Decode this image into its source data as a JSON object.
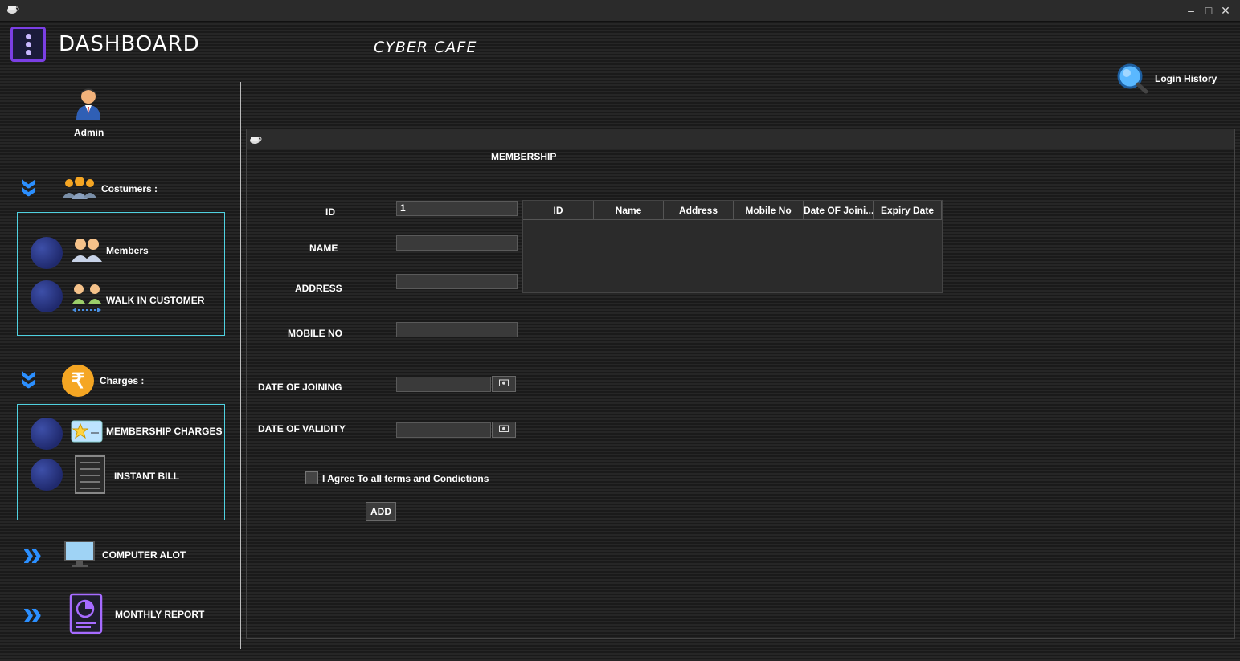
{
  "window": {
    "minimize": "–",
    "maximize": "□",
    "close": "✕"
  },
  "header": {
    "title": "DASHBOARD",
    "subtitle": "CYBER CAFE",
    "login_history": "Login History"
  },
  "user": {
    "name": "Admin"
  },
  "sidebar": {
    "customers_label": "Costumers :",
    "members": "Members",
    "walk_in": "WALK IN CUSTOMER",
    "charges_label": "Charges :",
    "rupee": "₹",
    "membership_charges": "MEMBERSHIP CHARGES",
    "instant_bill": "INSTANT BILL",
    "computer_alot": "COMPUTER  ALOT",
    "monthly_report": "MONTHLY REPORT"
  },
  "form": {
    "title": "MEMBERSHIP",
    "id_label": "ID",
    "id_value": "1",
    "name_label": "NAME",
    "name_value": "",
    "address_label": "ADDRESS",
    "address_value": "",
    "mobile_label": "MOBILE NO",
    "mobile_value": "",
    "doj_label": "DATE OF JOINING",
    "doj_value": "",
    "dov_label": "DATE OF VALIDITY",
    "dov_value": "",
    "agree_label": "I Agree To all terms and Condictions",
    "agree_checked": false,
    "add_button": "ADD"
  },
  "table": {
    "columns": [
      "ID",
      "Name",
      "Address",
      "Mobile No",
      "Date OF Joini...",
      "Expiry Date"
    ],
    "rows": []
  },
  "colors": {
    "accent_purple": "#7b3fe4",
    "nav_border": "#4fd1e0",
    "chevron_blue": "#2b8fff",
    "rupee_orange": "#f5a623"
  }
}
